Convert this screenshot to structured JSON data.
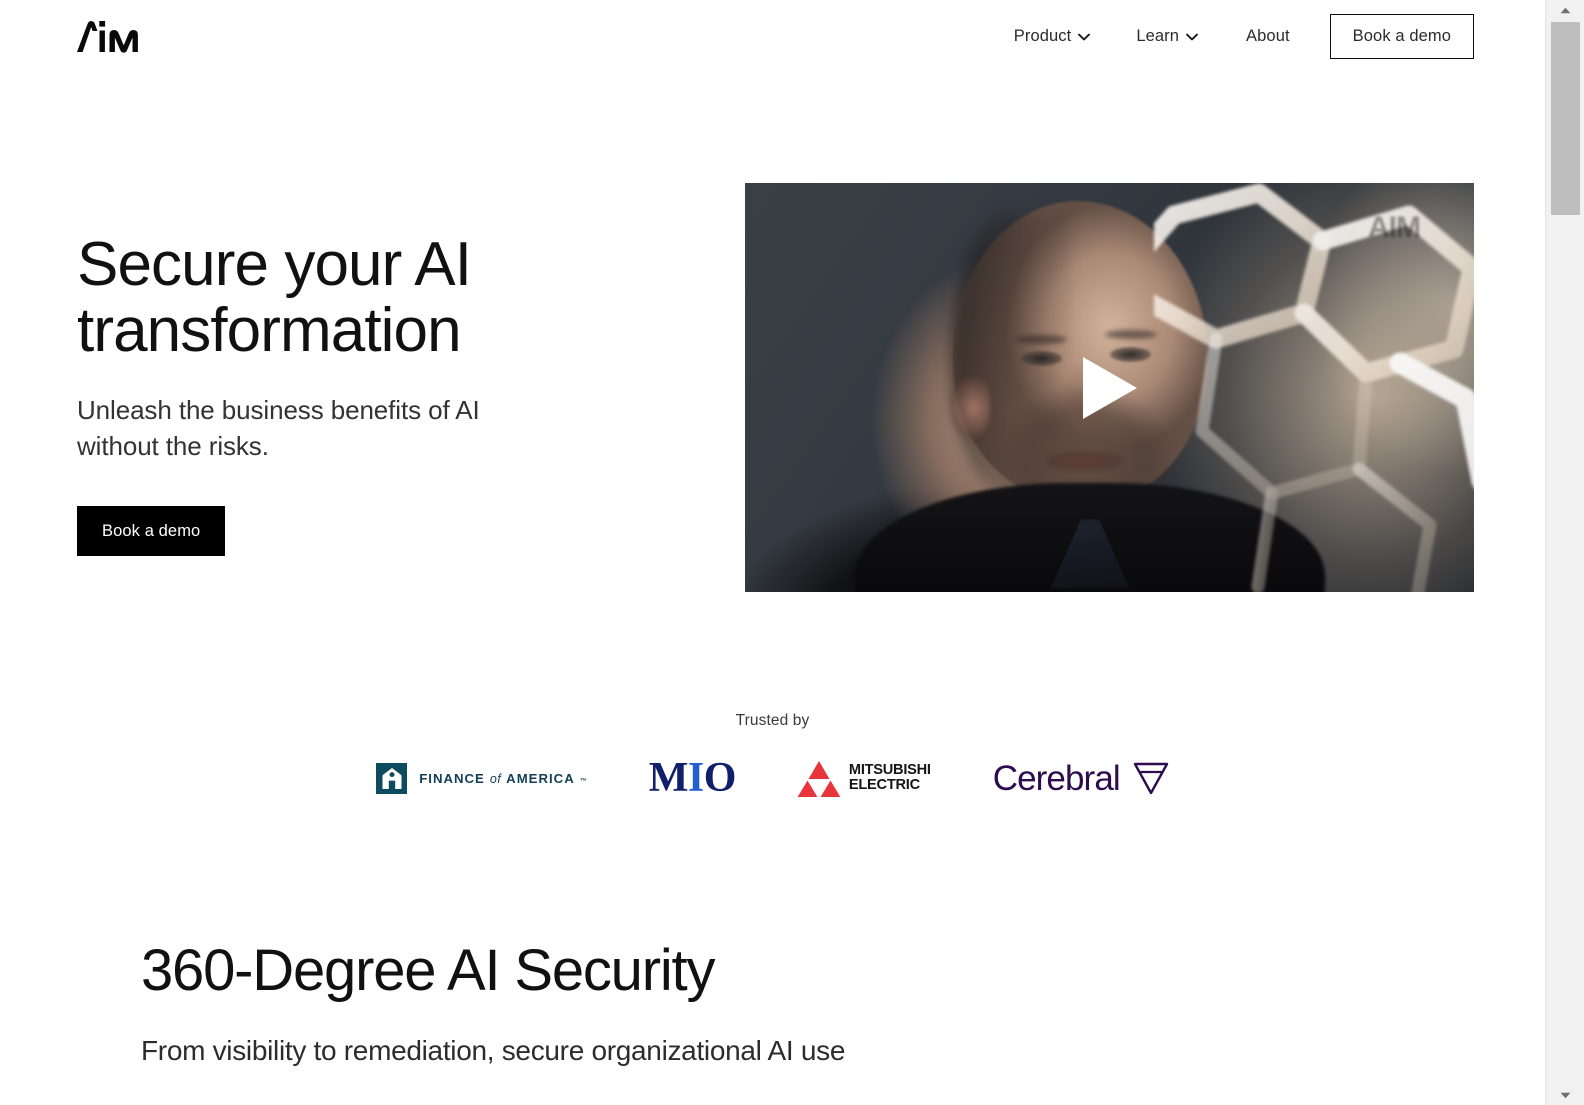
{
  "site": {
    "logo_text": "AIM",
    "logo_alt": "AIM logo"
  },
  "nav": {
    "items": [
      {
        "label": "Product",
        "has_dropdown": true,
        "icon": "chevron-down-icon"
      },
      {
        "label": "Learn",
        "has_dropdown": true,
        "icon": "chevron-down-icon"
      },
      {
        "label": "About",
        "has_dropdown": false,
        "icon": ""
      }
    ],
    "cta_label": "Book a demo"
  },
  "hero": {
    "title": "Secure your AI transformation",
    "subtitle": "Unleash the business benefits of AI without the risks.",
    "cta_label": "Book a demo",
    "video": {
      "alt": "Man speaking in front of glowing hexagonal lattice sculpture",
      "watermark": "AIM",
      "play_icon": "play-icon"
    }
  },
  "trusted": {
    "label": "Trusted by",
    "logos": [
      {
        "name": "Finance of America",
        "word_1": "FINANCE",
        "word_of": "of",
        "word_2": "AMERICA",
        "tm": "™",
        "color": "#123f55",
        "mark_color": "#0e4b5e"
      },
      {
        "name": "MIO",
        "letters": {
          "m": "M",
          "i": "I",
          "o": "O"
        },
        "color": "#10206b",
        "accent": "#1f5fd0"
      },
      {
        "name": "Mitsubishi Electric",
        "line_1": "MITSUBISHI",
        "line_2": "ELECTRIC",
        "color": "#151515",
        "mark_color": "#e8343b"
      },
      {
        "name": "Cerebral",
        "word": "Cerebral",
        "color": "#2e0a4f"
      }
    ]
  },
  "section_two": {
    "title": "360-Degree AI Security",
    "subtitle": "From visibility to remediation, secure organizational AI use"
  },
  "scrollbar": {
    "up_icon": "scroll-up-arrow-icon",
    "down_icon": "scroll-down-arrow-icon",
    "position": "top"
  },
  "colors": {
    "background": "#ffffff",
    "text": "#111111",
    "cta_background": "#000000",
    "cta_text": "#ffffff",
    "scrollbar_track": "#f1f1f1",
    "scrollbar_thumb": "#bdbdbd"
  }
}
